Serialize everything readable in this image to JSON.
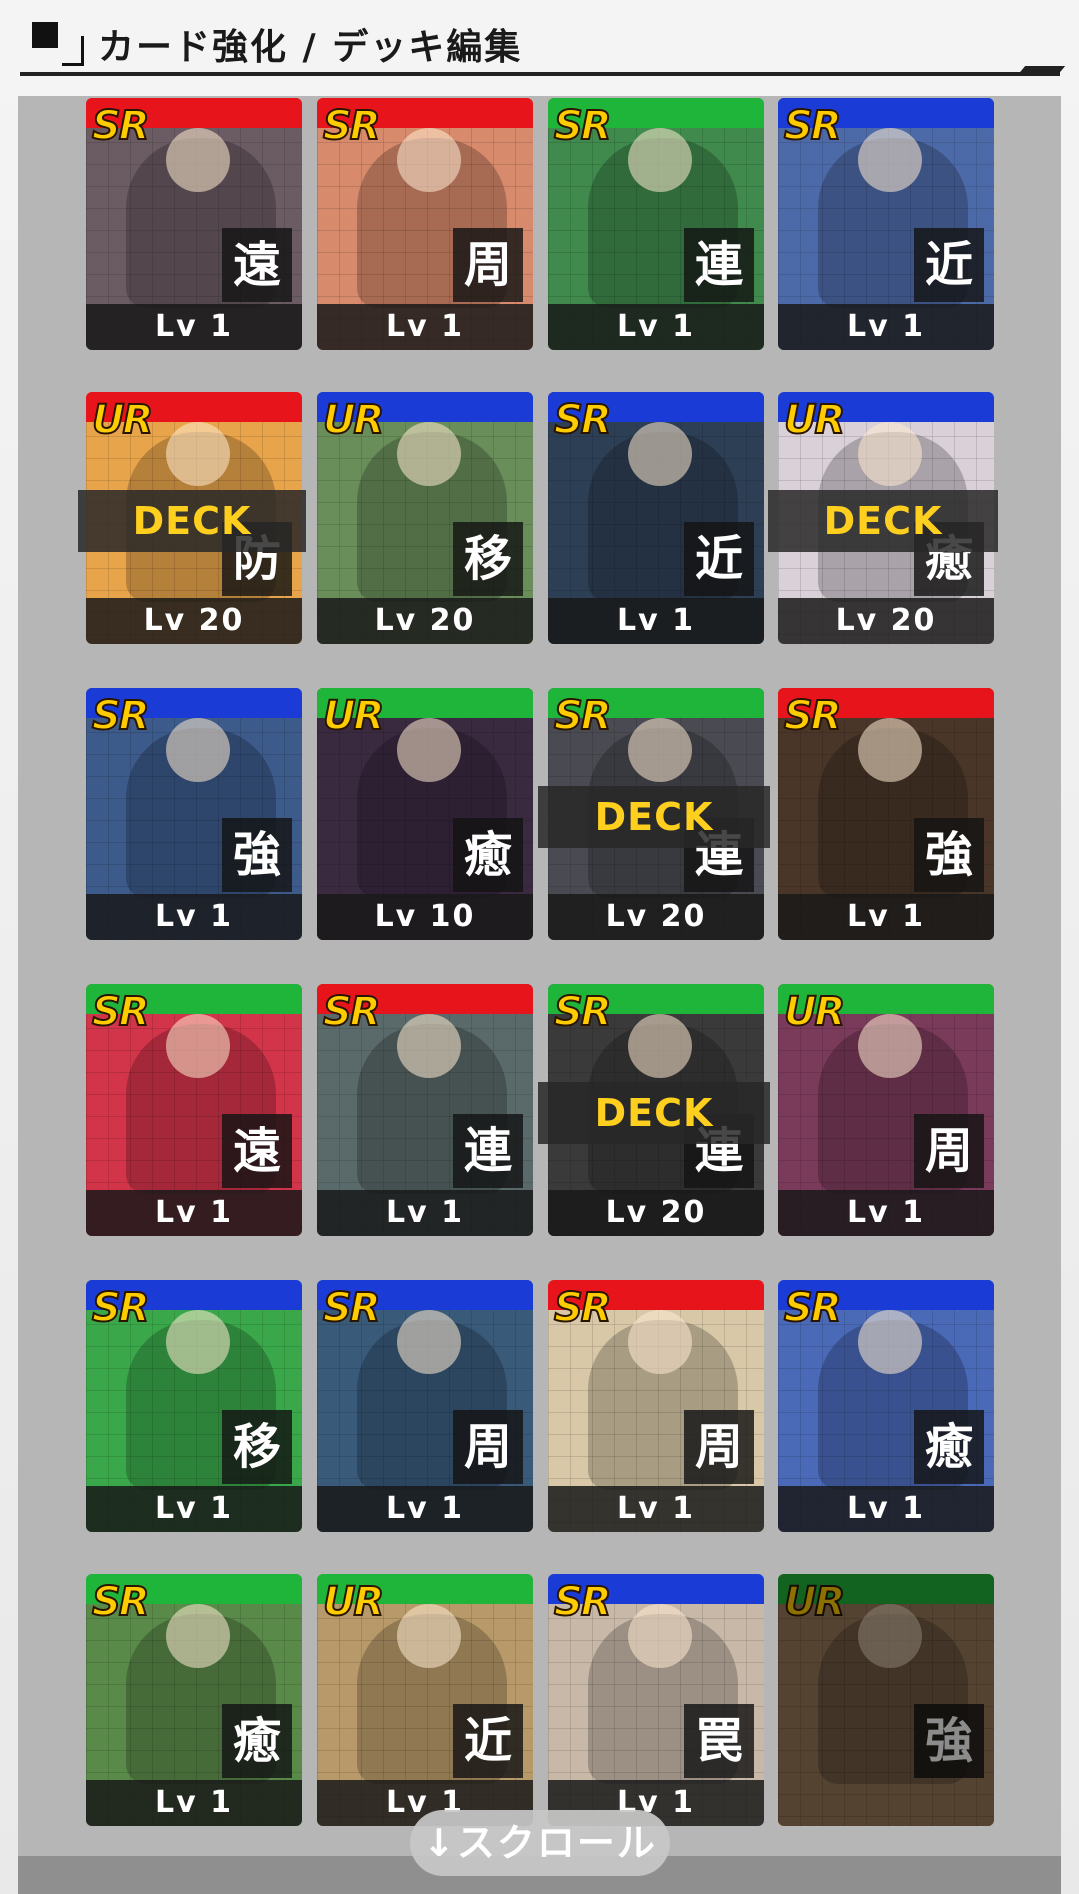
{
  "header": {
    "title": "カード強化 / デッキ編集"
  },
  "deck_label": "DECK",
  "scroll_label": "↓スクロール",
  "colors": {
    "red": "#e8141c",
    "green": "#1fb53a",
    "blue": "#1a3bd6",
    "gold": "#ffcc00"
  },
  "cards": [
    {
      "rarity": "SR",
      "type": "遠",
      "level": "Lv 1",
      "band": "red",
      "art": "#6b5b63",
      "deck": false
    },
    {
      "rarity": "SR",
      "type": "周",
      "level": "Lv 1",
      "band": "red",
      "art": "#d78a6c",
      "deck": false
    },
    {
      "rarity": "SR",
      "type": "連",
      "level": "Lv 1",
      "band": "green",
      "art": "#3f8a4c",
      "deck": false
    },
    {
      "rarity": "SR",
      "type": "近",
      "level": "Lv 1",
      "band": "blue",
      "art": "#4d6aa8",
      "deck": false
    },
    {
      "rarity": "UR",
      "type": "防",
      "level": "Lv 20",
      "band": "red",
      "art": "#e8a44a",
      "deck": true
    },
    {
      "rarity": "UR",
      "type": "移",
      "level": "Lv 20",
      "band": "blue",
      "art": "#6a8e5a",
      "deck": false
    },
    {
      "rarity": "SR",
      "type": "近",
      "level": "Lv 1",
      "band": "blue",
      "art": "#2d3f55",
      "deck": false
    },
    {
      "rarity": "UR",
      "type": "癒",
      "level": "Lv 20",
      "band": "blue",
      "art": "#d9d0d8",
      "deck": true
    },
    {
      "rarity": "SR",
      "type": "強",
      "level": "Lv 1",
      "band": "blue",
      "art": "#3c5a8a",
      "deck": false
    },
    {
      "rarity": "UR",
      "type": "癒",
      "level": "Lv 10",
      "band": "green",
      "art": "#3a2a40",
      "deck": false
    },
    {
      "rarity": "SR",
      "type": "連",
      "level": "Lv 20",
      "band": "green",
      "art": "#4a4a52",
      "deck": true
    },
    {
      "rarity": "SR",
      "type": "強",
      "level": "Lv 1",
      "band": "red",
      "art": "#4a3628",
      "deck": false
    },
    {
      "rarity": "SR",
      "type": "遠",
      "level": "Lv 1",
      "band": "green",
      "art": "#d2344a",
      "deck": false
    },
    {
      "rarity": "SR",
      "type": "連",
      "level": "Lv 1",
      "band": "red",
      "art": "#5a6a6a",
      "deck": false
    },
    {
      "rarity": "SR",
      "type": "連",
      "level": "Lv 20",
      "band": "green",
      "art": "#3a3a3a",
      "deck": true
    },
    {
      "rarity": "UR",
      "type": "周",
      "level": "Lv 1",
      "band": "green",
      "art": "#7a3a5a",
      "deck": false
    },
    {
      "rarity": "SR",
      "type": "移",
      "level": "Lv 1",
      "band": "blue",
      "art": "#3aa84a",
      "deck": false
    },
    {
      "rarity": "SR",
      "type": "周",
      "level": "Lv 1",
      "band": "blue",
      "art": "#3a5a7a",
      "deck": false
    },
    {
      "rarity": "SR",
      "type": "周",
      "level": "Lv 1",
      "band": "red",
      "art": "#d8c8a8",
      "deck": false
    },
    {
      "rarity": "SR",
      "type": "癒",
      "level": "Lv 1",
      "band": "blue",
      "art": "#4a6ab8",
      "deck": false
    },
    {
      "rarity": "SR",
      "type": "癒",
      "level": "Lv 1",
      "band": "green",
      "art": "#5a8a4a",
      "deck": false
    },
    {
      "rarity": "UR",
      "type": "近",
      "level": "Lv 1",
      "band": "green",
      "art": "#b89a6a",
      "deck": false
    },
    {
      "rarity": "SR",
      "type": "罠",
      "level": "Lv 1",
      "band": "blue",
      "art": "#c8b8a8",
      "deck": false
    },
    {
      "rarity": "UR",
      "type": "強",
      "level": "",
      "band": "green",
      "art": "#9a7a5a",
      "deck": false,
      "dim": true
    }
  ]
}
